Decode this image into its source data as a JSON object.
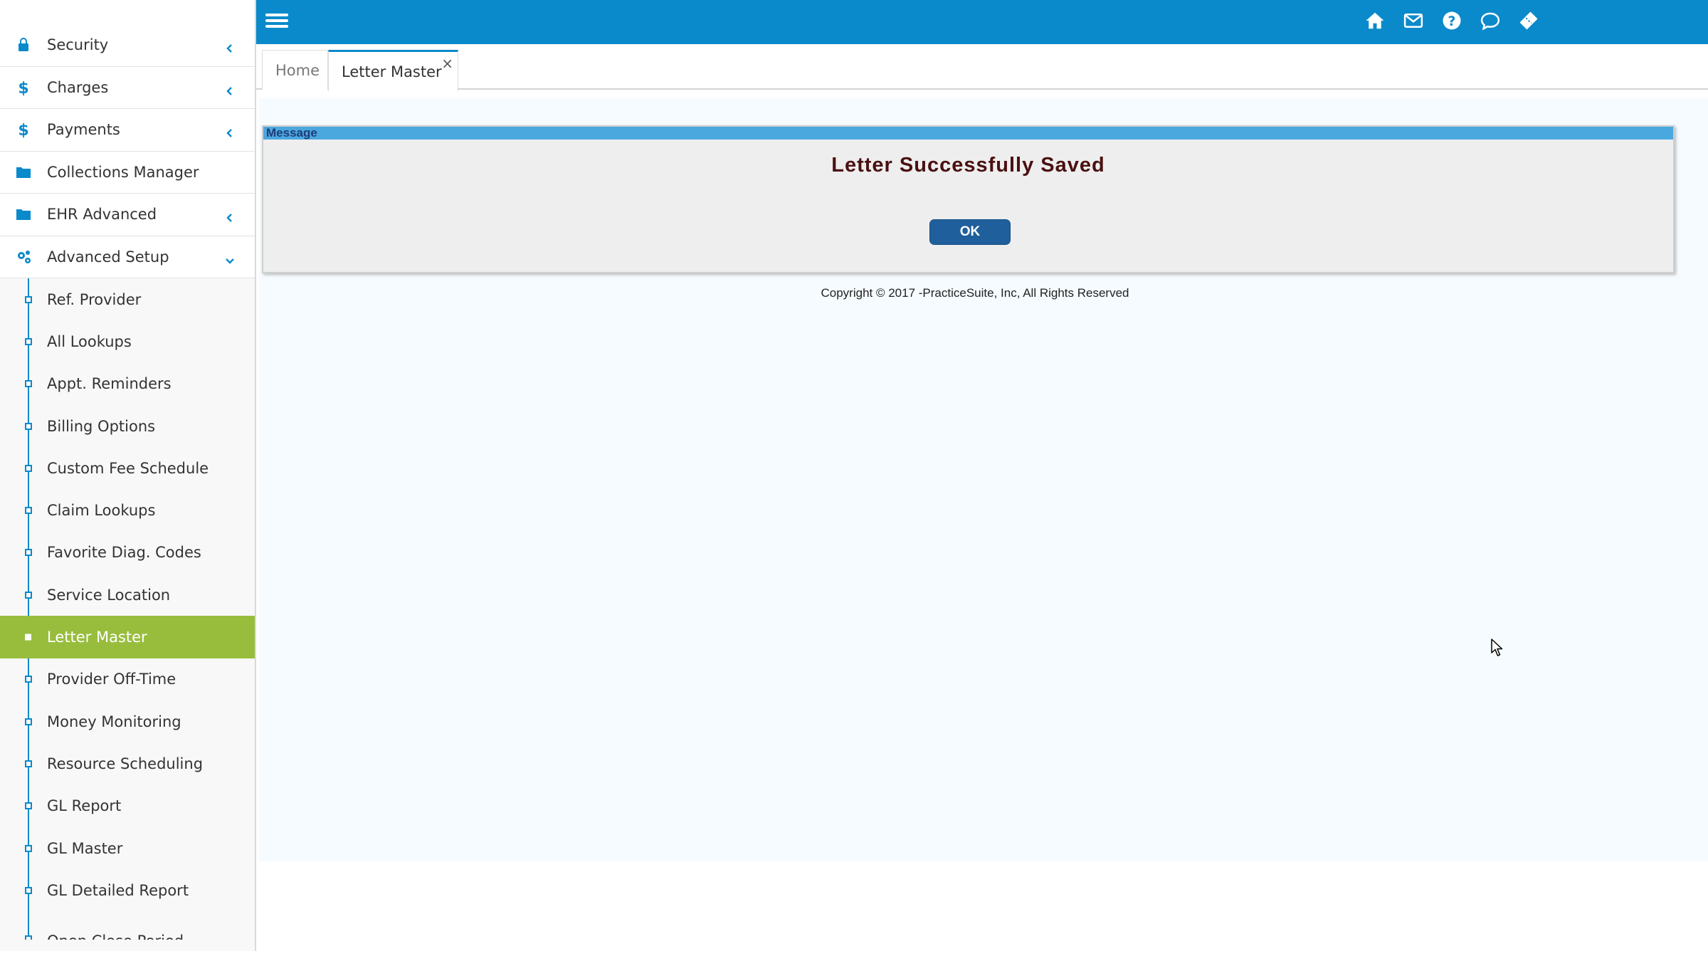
{
  "sidebar": {
    "menu": [
      {
        "label": "Security",
        "icon": "lock-icon"
      },
      {
        "label": "Charges",
        "icon": "dollar-icon"
      },
      {
        "label": "Payments",
        "icon": "dollar-icon"
      },
      {
        "label": "Collections Manager",
        "icon": "folder-icon"
      },
      {
        "label": "EHR Advanced",
        "icon": "folder-icon"
      },
      {
        "label": "Advanced Setup",
        "icon": "gears-icon"
      }
    ],
    "submenu": [
      {
        "label": "Ref. Provider"
      },
      {
        "label": "All Lookups"
      },
      {
        "label": "Appt. Reminders"
      },
      {
        "label": "Billing Options"
      },
      {
        "label": "Custom Fee Schedule"
      },
      {
        "label": "Claim Lookups"
      },
      {
        "label": "Favorite Diag. Codes"
      },
      {
        "label": "Service Location"
      },
      {
        "label": "Letter Master",
        "active": true
      },
      {
        "label": "Provider Off-Time"
      },
      {
        "label": "Money Monitoring"
      },
      {
        "label": "Resource Scheduling"
      },
      {
        "label": "GL Report"
      },
      {
        "label": "GL Master"
      },
      {
        "label": "GL Detailed Report"
      },
      {
        "label": "Open Close Period"
      }
    ]
  },
  "topbar": {
    "icons": [
      "home-icon",
      "mail-icon",
      "help-icon",
      "chat-icon",
      "ticket-icon"
    ],
    "color": "#0a8acb"
  },
  "tabs": [
    {
      "label": "Home"
    },
    {
      "label": "Letter Master",
      "active": true,
      "close": "×"
    }
  ],
  "dialog": {
    "header": "Message",
    "message": "Letter Successfully Saved",
    "ok_label": "OK"
  },
  "footer": {
    "copyright": "Copyright © 2017 -PracticeSuite, Inc, All Rights Reserved"
  },
  "colors": {
    "accent": "#0a8acb",
    "active_item": "#98bd3d",
    "ok_button": "#1f5f9c",
    "message_text": "#4a1010"
  }
}
